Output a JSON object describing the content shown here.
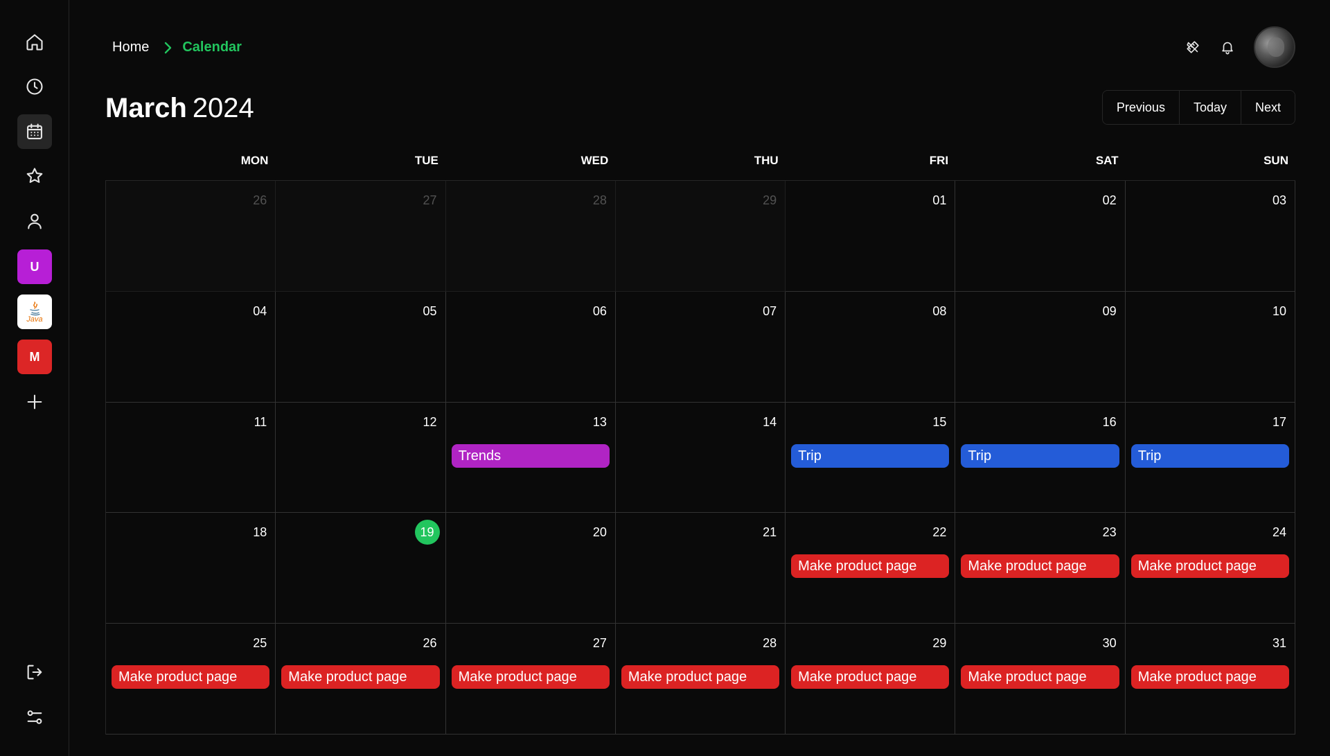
{
  "colors": {
    "accent": "#22c55e",
    "trends": "#b024c4",
    "trip": "#245cd8",
    "product": "#dc2323",
    "ws_u": "#b71fd6",
    "ws_m": "#dc2626"
  },
  "sidebar": {
    "nav": [
      {
        "icon": "home-icon"
      },
      {
        "icon": "clock-icon"
      },
      {
        "icon": "calendar-icon",
        "active": true
      },
      {
        "icon": "star-icon"
      },
      {
        "icon": "user-icon"
      }
    ],
    "workspaces": [
      {
        "label": "U",
        "color": "#b71fd6"
      },
      {
        "label": "Java",
        "icon": "java-icon"
      },
      {
        "label": "M",
        "color": "#dc2626"
      }
    ],
    "add_icon": "plus-icon",
    "logout_icon": "logout-icon",
    "settings_icon": "sliders-icon"
  },
  "header": {
    "breadcrumb_home": "Home",
    "breadcrumb_current": "Calendar",
    "month": "March",
    "year": "2024",
    "prev_label": "Previous",
    "today_label": "Today",
    "next_label": "Next"
  },
  "calendar": {
    "weekdays": [
      "MON",
      "TUE",
      "WED",
      "THU",
      "FRI",
      "SAT",
      "SUN"
    ],
    "weeks": [
      [
        {
          "day": "26",
          "other": true
        },
        {
          "day": "27",
          "other": true
        },
        {
          "day": "28",
          "other": true
        },
        {
          "day": "29",
          "other": true
        },
        {
          "day": "01"
        },
        {
          "day": "02"
        },
        {
          "day": "03"
        }
      ],
      [
        {
          "day": "04"
        },
        {
          "day": "05"
        },
        {
          "day": "06"
        },
        {
          "day": "07"
        },
        {
          "day": "08"
        },
        {
          "day": "09"
        },
        {
          "day": "10"
        }
      ],
      [
        {
          "day": "11"
        },
        {
          "day": "12"
        },
        {
          "day": "13",
          "event": {
            "title": "Trends",
            "color": "#b024c4"
          }
        },
        {
          "day": "14"
        },
        {
          "day": "15",
          "event": {
            "title": "Trip",
            "color": "#245cd8"
          }
        },
        {
          "day": "16",
          "event": {
            "title": "Trip",
            "color": "#245cd8"
          }
        },
        {
          "day": "17",
          "event": {
            "title": "Trip",
            "color": "#245cd8"
          }
        }
      ],
      [
        {
          "day": "18"
        },
        {
          "day": "19",
          "today": true
        },
        {
          "day": "20"
        },
        {
          "day": "21"
        },
        {
          "day": "22",
          "event": {
            "title": "Make product page",
            "color": "#dc2323"
          }
        },
        {
          "day": "23",
          "event": {
            "title": "Make product page",
            "color": "#dc2323"
          }
        },
        {
          "day": "24",
          "event": {
            "title": "Make product page",
            "color": "#dc2323"
          }
        }
      ],
      [
        {
          "day": "25",
          "event": {
            "title": "Make product page",
            "color": "#dc2323"
          }
        },
        {
          "day": "26",
          "event": {
            "title": "Make product page",
            "color": "#dc2323"
          }
        },
        {
          "day": "27",
          "event": {
            "title": "Make product page",
            "color": "#dc2323"
          }
        },
        {
          "day": "28",
          "event": {
            "title": "Make product page",
            "color": "#dc2323"
          }
        },
        {
          "day": "29",
          "event": {
            "title": "Make product page",
            "color": "#dc2323"
          }
        },
        {
          "day": "30",
          "event": {
            "title": "Make product page",
            "color": "#dc2323"
          }
        },
        {
          "day": "31",
          "event": {
            "title": "Make product page",
            "color": "#dc2323"
          }
        }
      ]
    ]
  }
}
